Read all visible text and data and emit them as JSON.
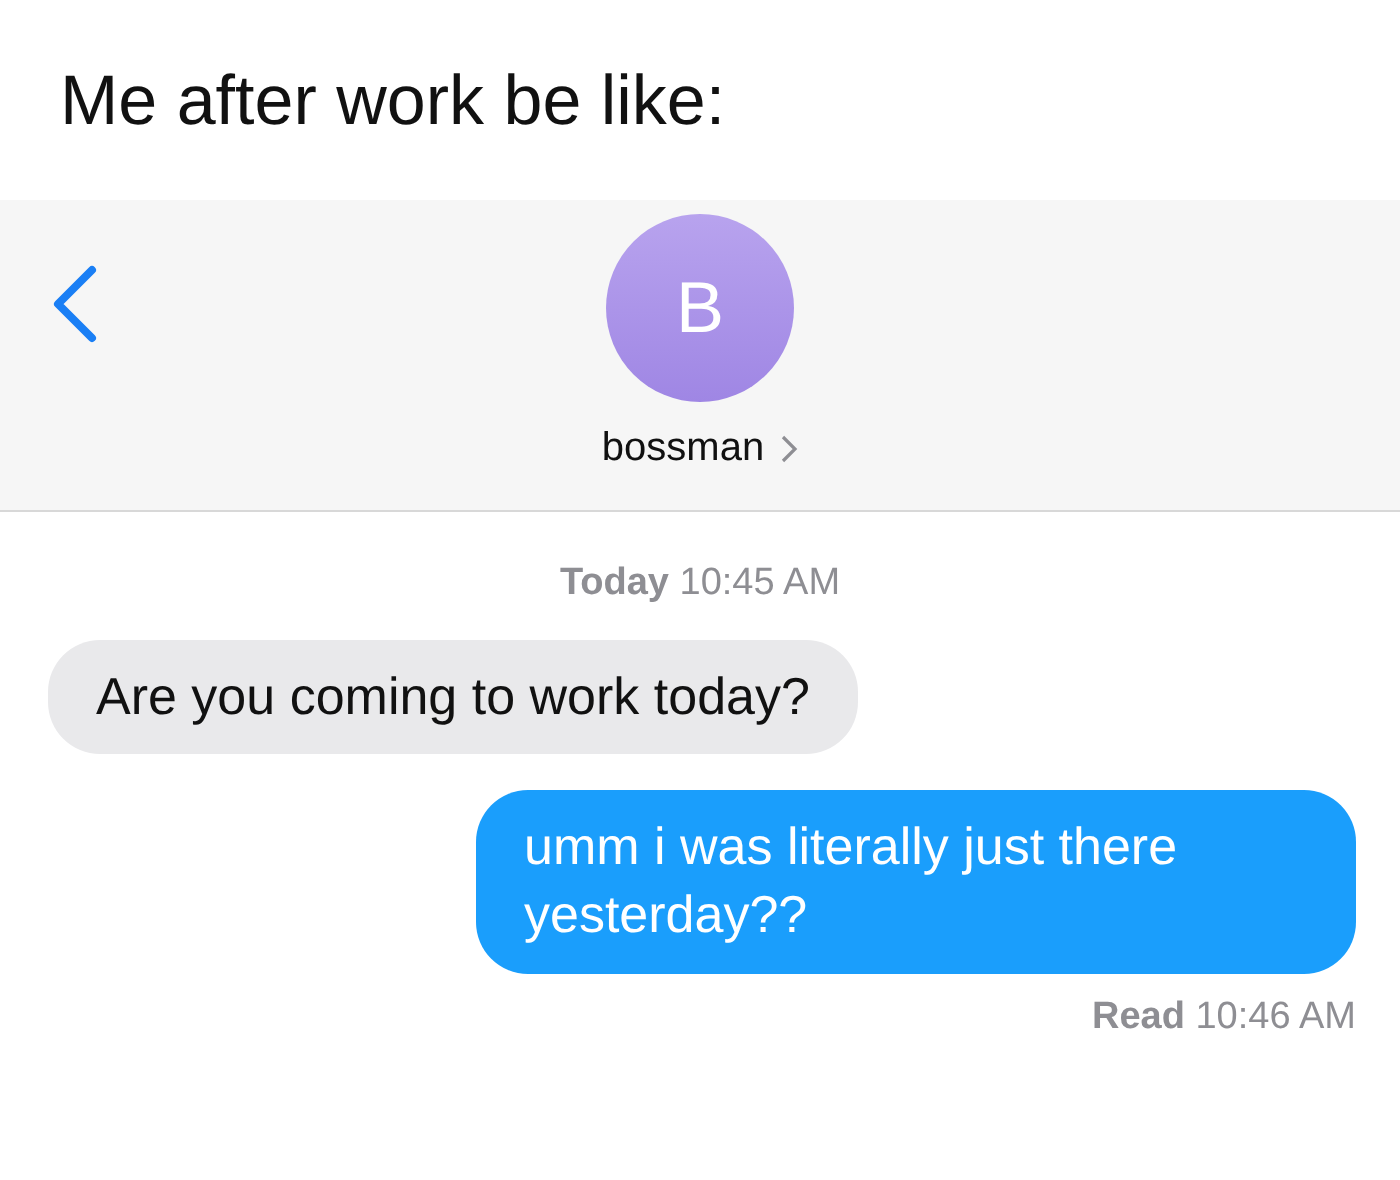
{
  "caption": "Me after work be like:",
  "header": {
    "avatar_initial": "B",
    "contact_name": "bossman"
  },
  "timestamp": "**Today** 10:45 AM",
  "messages": [
    {
      "kind": "incoming",
      "text": "Are you coming to work today?"
    },
    {
      "kind": "outgoing",
      "text": "umm i was literally just there yesterday??"
    }
  ],
  "receipt": "**Read** 10:46 AM"
}
